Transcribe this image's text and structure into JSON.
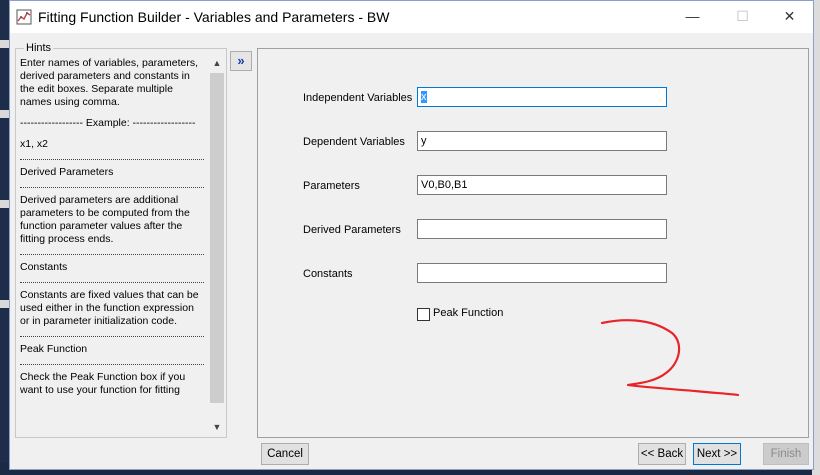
{
  "window": {
    "title": "Fitting Function Builder - Variables and Parameters - BW",
    "minimize_glyph": "—",
    "maximize_glyph": "☐",
    "close_glyph": "✕"
  },
  "hints": {
    "legend": "Hints",
    "intro": "Enter names of variables, parameters, derived parameters and constants in the edit boxes. Separate multiple names using comma.",
    "example_header": "------------------ Example: ------------------",
    "example_value": "x1, x2",
    "derived_title": "Derived Parameters",
    "derived_text": "Derived parameters are additional parameters to be computed from the function parameter values after the fitting process ends.",
    "constants_title": "Constants",
    "constants_text": "Constants are fixed values that can be used either in the function expression or in parameter initialization code.",
    "peak_title": "Peak Function",
    "peak_text": "Check the Peak Function box if you want to use your function for fitting"
  },
  "expand_button": "»",
  "form": {
    "independent_label": "Independent Variables",
    "independent_value": "x",
    "dependent_label": "Dependent Variables",
    "dependent_value": "y",
    "parameters_label": "Parameters",
    "parameters_value": "V0,B0,B1",
    "derived_label": "Derived Parameters",
    "derived_value": "",
    "constants_label": "Constants",
    "constants_value": "",
    "peak_label": "Peak Function",
    "peak_checked": false
  },
  "buttons": {
    "cancel": "Cancel",
    "back": "<< Back",
    "next": "Next >>",
    "finish": "Finish"
  },
  "colors": {
    "annotation": "#e8242b",
    "focus": "#0078d7"
  }
}
